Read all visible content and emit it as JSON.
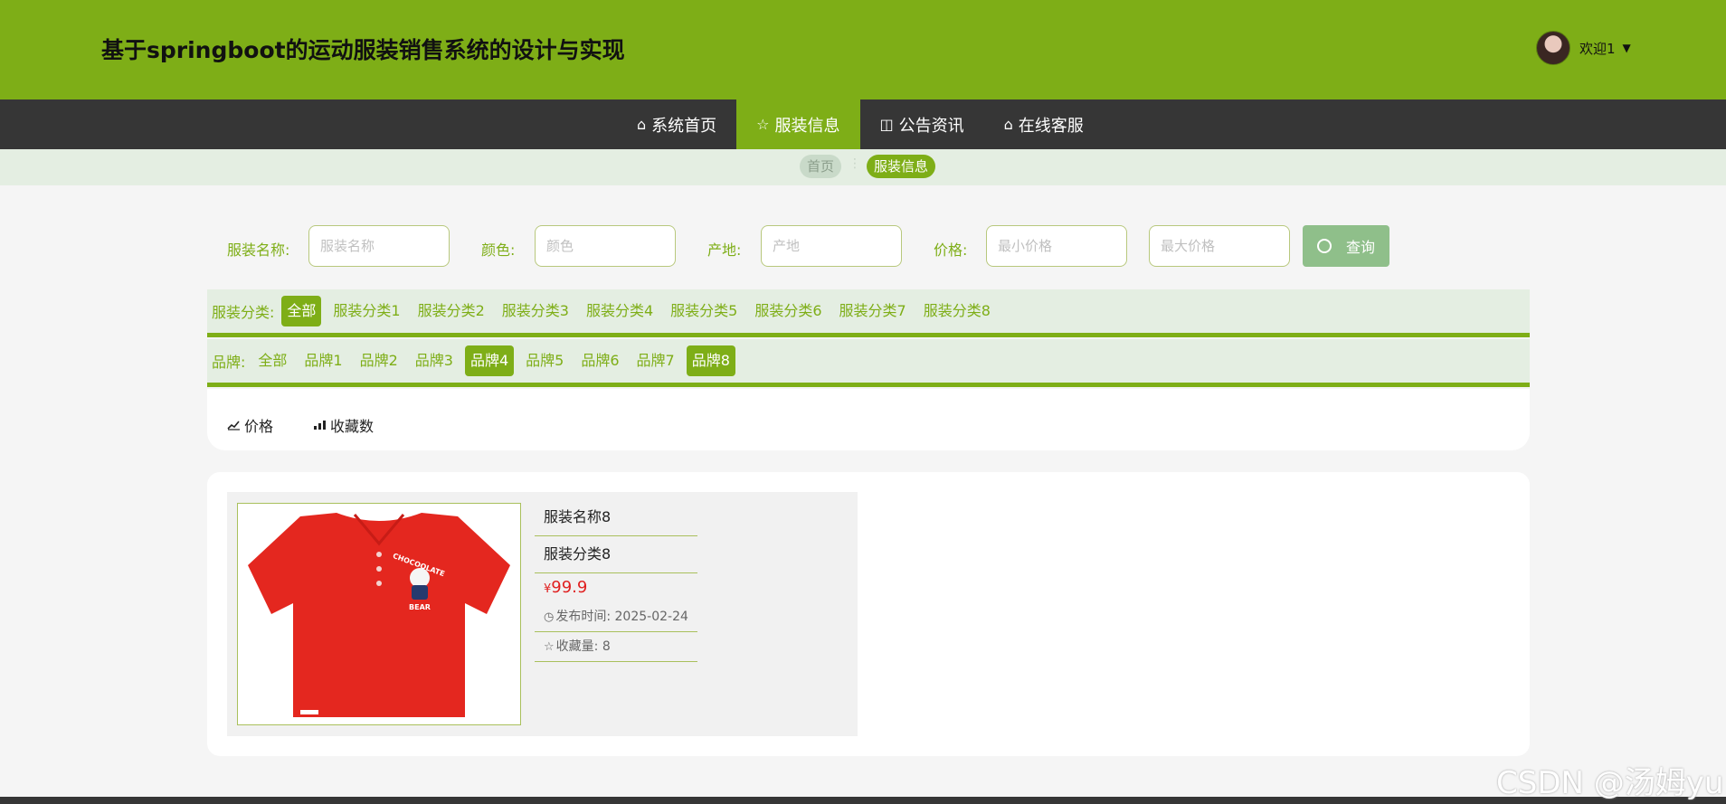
{
  "header": {
    "title": "基于springboot的运动服装销售系统的设计与实现",
    "user_label": "欢迎1",
    "caret": "▼"
  },
  "nav": {
    "items": [
      {
        "icon": "⌂",
        "label": "系统首页"
      },
      {
        "icon": "☆",
        "label": "服装信息"
      },
      {
        "icon": "◫",
        "label": "公告资讯"
      },
      {
        "icon": "⌂",
        "label": "在线客服"
      }
    ],
    "active_index": 1
  },
  "breadcrumb": {
    "home": "首页",
    "separator": "⋮",
    "current": "服装信息"
  },
  "filters": {
    "name_label": "服装名称:",
    "name_placeholder": "服装名称",
    "color_label": "颜色:",
    "color_placeholder": "颜色",
    "origin_label": "产地:",
    "origin_placeholder": "产地",
    "price_label": "价格:",
    "min_price_placeholder": "最小价格",
    "max_price_placeholder": "最大价格",
    "search_label": "查询"
  },
  "categories": {
    "label": "服装分类:",
    "items": [
      "全部",
      "服装分类1",
      "服装分类2",
      "服装分类3",
      "服装分类4",
      "服装分类5",
      "服装分类6",
      "服装分类7",
      "服装分类8"
    ],
    "active": "全部"
  },
  "brands": {
    "label": "品牌:",
    "items": [
      "全部",
      "品牌1",
      "品牌2",
      "品牌3",
      "品牌4",
      "品牌5",
      "品牌6",
      "品牌7",
      "品牌8"
    ],
    "highlighted": [
      "品牌4",
      "品牌8"
    ]
  },
  "sort": {
    "price_label": "价格",
    "favorites_label": "收藏数"
  },
  "product": {
    "name": "服装名称8",
    "category": "服装分类8",
    "currency": "¥",
    "price": "99.9",
    "publish_label": "发布时间:",
    "publish_date": "2025-02-24",
    "favorites_label": "收藏量:",
    "favorites_count": "8",
    "shirt_print_top": "CHOCOOLATE",
    "shirt_print_bottom": "BEAR"
  },
  "watermark": "CSDN @汤姆yu",
  "colors": {
    "brand_green": "#7eae17",
    "nav_dark": "#363636",
    "price_red": "#e02020"
  }
}
